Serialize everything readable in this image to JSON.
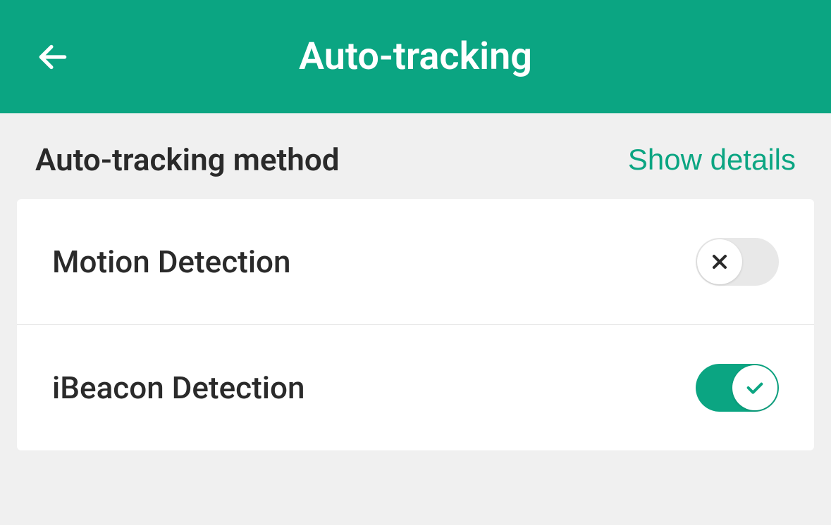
{
  "header": {
    "title": "Auto-tracking"
  },
  "section": {
    "title": "Auto-tracking method",
    "show_details": "Show details"
  },
  "methods": [
    {
      "label": "Motion Detection",
      "enabled": false
    },
    {
      "label": "iBeacon Detection",
      "enabled": true
    }
  ]
}
